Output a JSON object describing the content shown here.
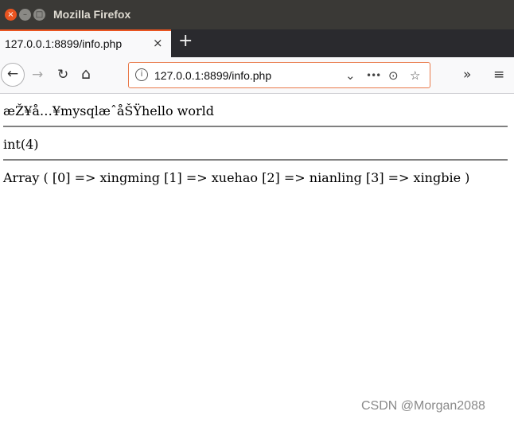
{
  "window": {
    "title": "Mozilla Firefox"
  },
  "tabs": [
    {
      "label": "127.0.0.1:8899/info.php",
      "close_glyph": "×"
    }
  ],
  "new_tab_glyph": "+",
  "url": "127.0.0.1:8899/info.php",
  "icons": {
    "back": "←",
    "forward": "→",
    "reload": "↻",
    "home": "⌂",
    "url_info": "i",
    "url_dropdown": "⌄",
    "page_actions": "•••",
    "pocket": "⊙",
    "bookmark": "☆",
    "overflow": "»",
    "menu": "≡",
    "wm_close": "×",
    "wm_min": "–",
    "wm_max": "□"
  },
  "accent_color": "#e95420",
  "page": {
    "lines": [
      "æŽ¥å…¥mysqlæˆåŠŸhello world",
      "int(4)",
      "Array ( [0] => xingming [1] => xuehao [2] => nianling [3] => xingbie )"
    ]
  },
  "watermark": "CSDN @Morgan2088"
}
